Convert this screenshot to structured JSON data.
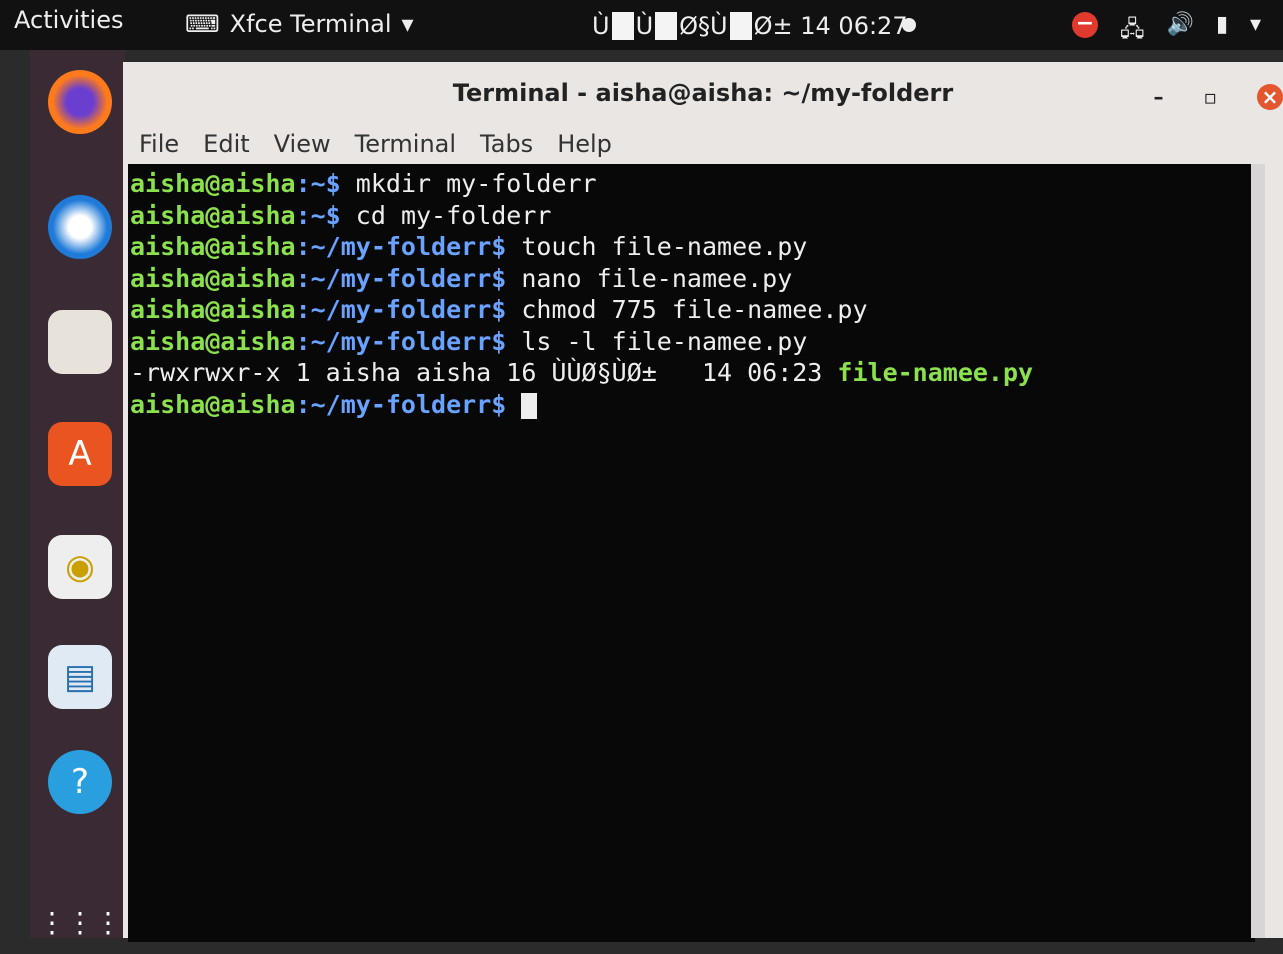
{
  "topbar": {
    "activities": "Activities",
    "app_name": "Xfce Terminal",
    "clock_parts": [
      "Ù",
      "Ù",
      "Ø§Ù",
      "Ø± 14 06:27"
    ]
  },
  "window": {
    "title": "Terminal - aisha@aisha: ~/my-folderr",
    "menu": [
      "File",
      "Edit",
      "View",
      "Terminal",
      "Tabs",
      "Help"
    ]
  },
  "terminal": {
    "lines": [
      {
        "user": "aisha@aisha",
        "path": ":~$",
        "cmd": " mkdir my-folderr"
      },
      {
        "user": "aisha@aisha",
        "path": ":~$",
        "cmd": " cd my-folderr"
      },
      {
        "user": "aisha@aisha",
        "path": ":~/my-folderr$",
        "cmd": " touch file-namee.py"
      },
      {
        "user": "aisha@aisha",
        "path": ":~/my-folderr$",
        "cmd": " nano file-namee.py"
      },
      {
        "user": "aisha@aisha",
        "path": ":~/my-folderr$",
        "cmd": " chmod 775 file-namee.py"
      },
      {
        "user": "aisha@aisha",
        "path": ":~/my-folderr$",
        "cmd": " ls -l file-namee.py"
      }
    ],
    "output": {
      "text": "-rwxrwxr-x 1 aisha aisha 16 ÙÙØ§ÙØ±   14 06:23 ",
      "file": "file-namee.py"
    },
    "prompt": {
      "user": "aisha@aisha",
      "path": ":~/my-folderr$"
    }
  }
}
